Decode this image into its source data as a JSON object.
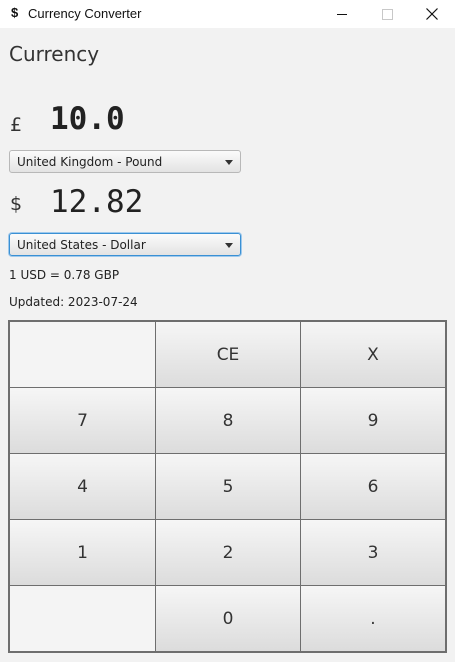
{
  "window": {
    "icon": "$",
    "title": "Currency Converter",
    "controls": [
      "minimize-icon",
      "maximize-icon",
      "close-icon"
    ]
  },
  "heading": "Currency",
  "from": {
    "symbol": "£",
    "amount": "10.0",
    "currency": "United Kingdom - Pound"
  },
  "to": {
    "symbol": "$",
    "amount": "12.82",
    "currency": "United States - Dollar"
  },
  "rate_text": "1 USD = 0.78 GBP",
  "updated_text": "Updated: 2023-07-24",
  "keypad": {
    "rows": [
      [
        "",
        "CE",
        "X"
      ],
      [
        "7",
        "8",
        "9"
      ],
      [
        "4",
        "5",
        "6"
      ],
      [
        "1",
        "2",
        "3"
      ],
      [
        "",
        "0",
        "."
      ]
    ]
  },
  "colors": {
    "focus": "#3a90d4",
    "background": "#f2f2f2"
  }
}
